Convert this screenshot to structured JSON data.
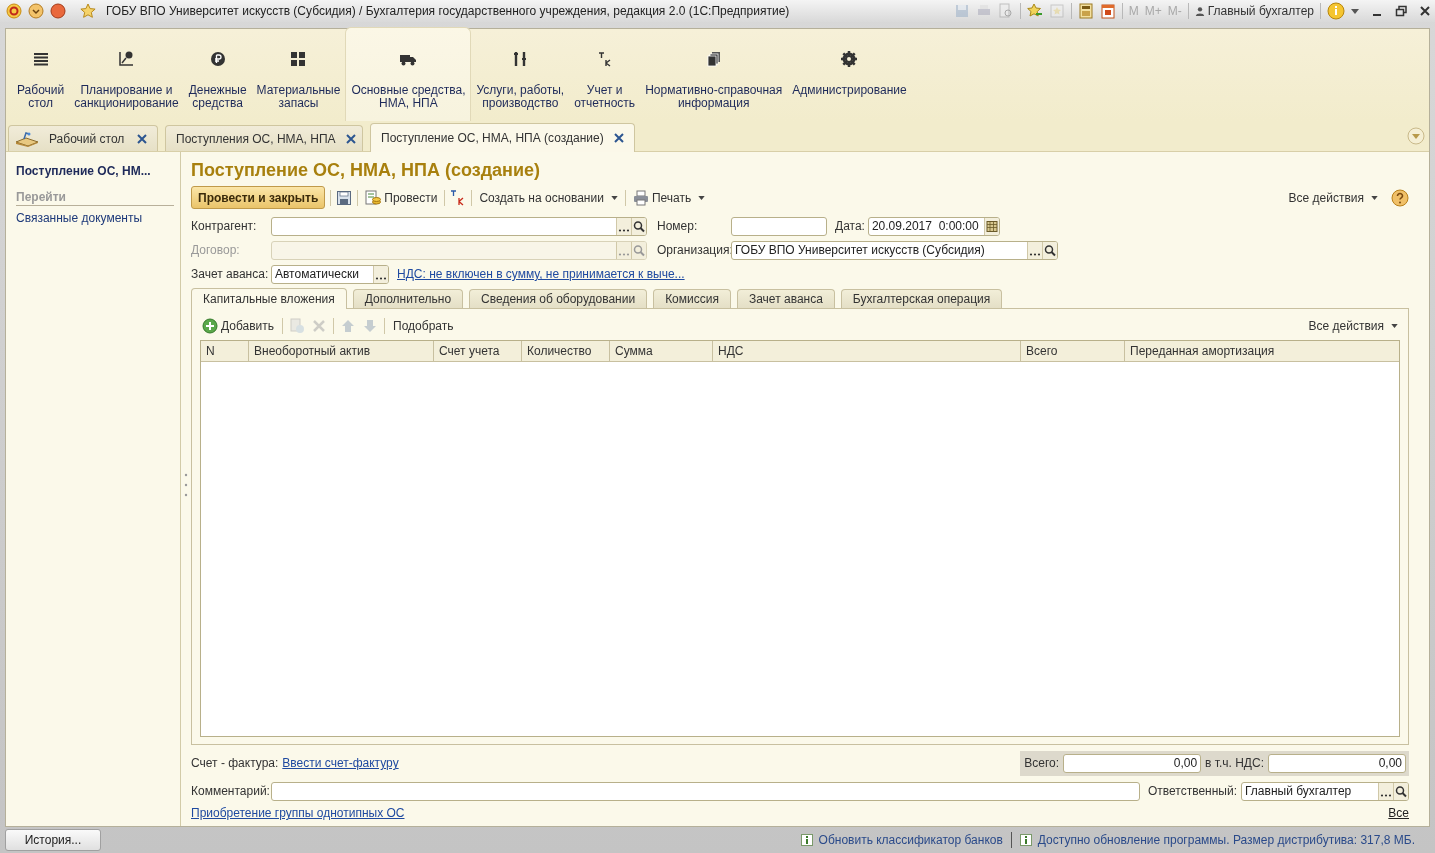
{
  "window": {
    "title": "ГОБУ ВПО Университет искусств (Субсидия) / Бухгалтерия государственного учреждения, редакция 2.0  (1С:Предприятие)",
    "memory_buttons": [
      "M",
      "M+",
      "M-"
    ],
    "user": "Главный бухгалтер"
  },
  "sections": [
    {
      "lines": [
        "Рабочий",
        "стол"
      ],
      "selected": false
    },
    {
      "lines": [
        "Планирование и",
        "санкционирование"
      ],
      "selected": false
    },
    {
      "lines": [
        "Денежные",
        "средства"
      ],
      "selected": false
    },
    {
      "lines": [
        "Материальные",
        "запасы"
      ],
      "selected": false
    },
    {
      "lines": [
        "Основные средства,",
        "НМА, НПА"
      ],
      "selected": true
    },
    {
      "lines": [
        "Услуги, работы,",
        "производство"
      ],
      "selected": false
    },
    {
      "lines": [
        "Учет и",
        "отчетность"
      ],
      "selected": false
    },
    {
      "lines": [
        "Нормативно-справочная",
        "информация"
      ],
      "selected": false
    },
    {
      "lines": [
        "Администрирование"
      ],
      "selected": false
    }
  ],
  "open_tabs": [
    {
      "label": "Рабочий стол",
      "selected": false
    },
    {
      "label": "Поступления ОС, НМА, НПА",
      "selected": false
    },
    {
      "label": "Поступление ОС, НМА, НПА (создание)",
      "selected": true
    }
  ],
  "side_panel": {
    "current": "Поступление ОС, НМ...",
    "group": "Перейти",
    "links": [
      "Связанные документы"
    ]
  },
  "form": {
    "title": "Поступление ОС, НМА, НПА (создание)",
    "toolbar": {
      "post_close": "Провести и закрыть",
      "post": "Провести",
      "create_based": "Создать на основании",
      "print": "Печать",
      "all_actions": "Все действия"
    },
    "counterparty": {
      "label": "Контрагент:"
    },
    "number": {
      "label": "Номер:"
    },
    "date": {
      "label": "Дата:",
      "value": "20.09.2017  0:00:00"
    },
    "contract": {
      "label": "Договор:",
      "disabled": true
    },
    "organization": {
      "label": "Организация:",
      "value": "ГОБУ ВПО Университет искусств (Субсидия)"
    },
    "advance": {
      "label": "Зачет аванса:",
      "value": "Автоматически"
    },
    "vat_link": "НДС: не включен в сумму, не принимается к выче...",
    "tabs": [
      {
        "label": "Капитальные вложения",
        "selected": true
      },
      {
        "label": "Дополнительно",
        "selected": false
      },
      {
        "label": "Сведения об оборудовании",
        "selected": false
      },
      {
        "label": "Комиссия",
        "selected": false
      },
      {
        "label": "Зачет аванса",
        "selected": false
      },
      {
        "label": "Бухгалтерская операция",
        "selected": false
      }
    ],
    "table": {
      "toolbar": {
        "add": "Добавить",
        "pick": "Подобрать",
        "all_actions": "Все действия"
      },
      "columns": [
        "N",
        "Внеоборотный актив",
        "Счет учета",
        "Количество",
        "Сумма",
        "НДС",
        "Всего",
        "Переданная амортизация"
      ]
    },
    "footer": {
      "invoice_label": "Счет - фактура:",
      "invoice_link": "Ввести счет-фактуру",
      "total_label": "Всего:",
      "total": "0,00",
      "vat_label": "в т.ч. НДС:",
      "vat": "0,00",
      "comment_label": "Комментарий:",
      "responsible_label": "Ответственный:",
      "responsible": "Главный бухгалтер",
      "group_link": "Приобретение группы однотипных ОС",
      "all_link": "Все"
    }
  },
  "history_button": "История...",
  "status_messages": [
    "Обновить классификатор банков",
    "Доступно обновление программы. Размер дистрибутива: 317,8 МБ."
  ]
}
